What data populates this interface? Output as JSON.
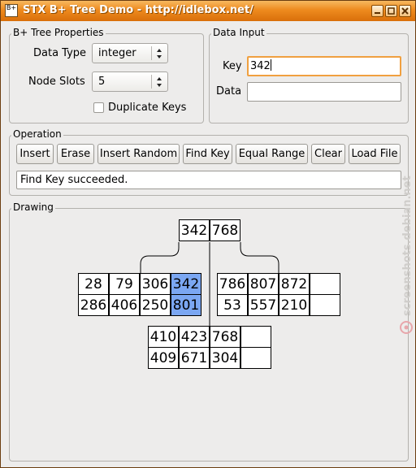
{
  "window": {
    "title": "STX B+ Tree Demo - http://idlebox.net/",
    "icon_text": "B+",
    "title_color": "#ee8a1e",
    "controls": [
      "minimize-icon",
      "maximize-icon",
      "close-icon"
    ]
  },
  "properties": {
    "title": "B+ Tree Properties",
    "data_type_label": "Data Type",
    "data_type_value": "integer",
    "node_slots_label": "Node Slots",
    "node_slots_value": "5",
    "duplicate_keys_label": "Duplicate Keys",
    "duplicate_keys_checked": false
  },
  "data_input": {
    "title": "Data Input",
    "key_label": "Key",
    "key_value": "342",
    "data_label": "Data",
    "data_value": ""
  },
  "operation": {
    "title": "Operation",
    "buttons": [
      "Insert",
      "Erase",
      "Insert Random",
      "Find Key",
      "Equal Range",
      "Clear",
      "Load File"
    ],
    "status": "Find Key succeeded."
  },
  "drawing": {
    "title": "Drawing",
    "highlight_color": "#7ba7f2",
    "root": {
      "keys": [
        "342",
        "768"
      ]
    },
    "leaves": [
      {
        "keys": [
          "28",
          "79",
          "306",
          "342"
        ],
        "data": [
          "286",
          "406",
          "250",
          "801"
        ],
        "highlight": 3
      },
      {
        "keys": [
          "786",
          "807",
          "872",
          ""
        ],
        "data": [
          "53",
          "557",
          "210",
          ""
        ],
        "highlight": -1
      },
      {
        "keys": [
          "410",
          "423",
          "768",
          ""
        ],
        "data": [
          "409",
          "671",
          "304",
          ""
        ],
        "highlight": -1
      }
    ]
  },
  "watermark": {
    "text": "screenshots.debian.net"
  }
}
